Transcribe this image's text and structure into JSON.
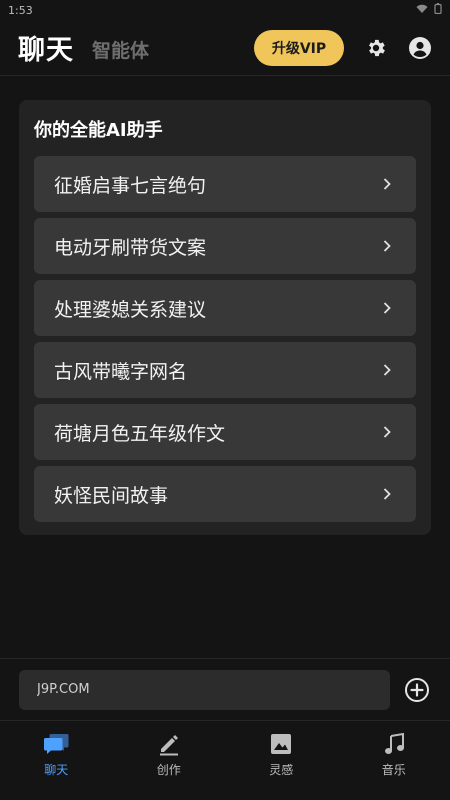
{
  "status_bar": {
    "time": "1:53"
  },
  "header": {
    "tab_chat": "聊天",
    "tab_agent": "智能体",
    "vip_label": "升级VIP"
  },
  "card": {
    "title": "你的全能AI助手",
    "items": [
      {
        "label": "征婚启事七言绝句"
      },
      {
        "label": "电动牙刷带货文案"
      },
      {
        "label": "处理婆媳关系建议"
      },
      {
        "label": "古风带曦字网名"
      },
      {
        "label": "荷塘月色五年级作文"
      },
      {
        "label": "妖怪民间故事"
      }
    ]
  },
  "input": {
    "placeholder": "J9P.COM"
  },
  "nav": {
    "active": "chat",
    "items": [
      {
        "label": "聊天",
        "icon": "chat-bubbles-icon"
      },
      {
        "label": "创作",
        "icon": "pencil-icon"
      },
      {
        "label": "灵感",
        "icon": "image-icon"
      },
      {
        "label": "音乐",
        "icon": "music-note-icon"
      }
    ]
  },
  "colors": {
    "background": "#141414",
    "card": "#232323",
    "item": "#383838",
    "vip": "#f0c65a",
    "accent": "#4ea1ff"
  }
}
